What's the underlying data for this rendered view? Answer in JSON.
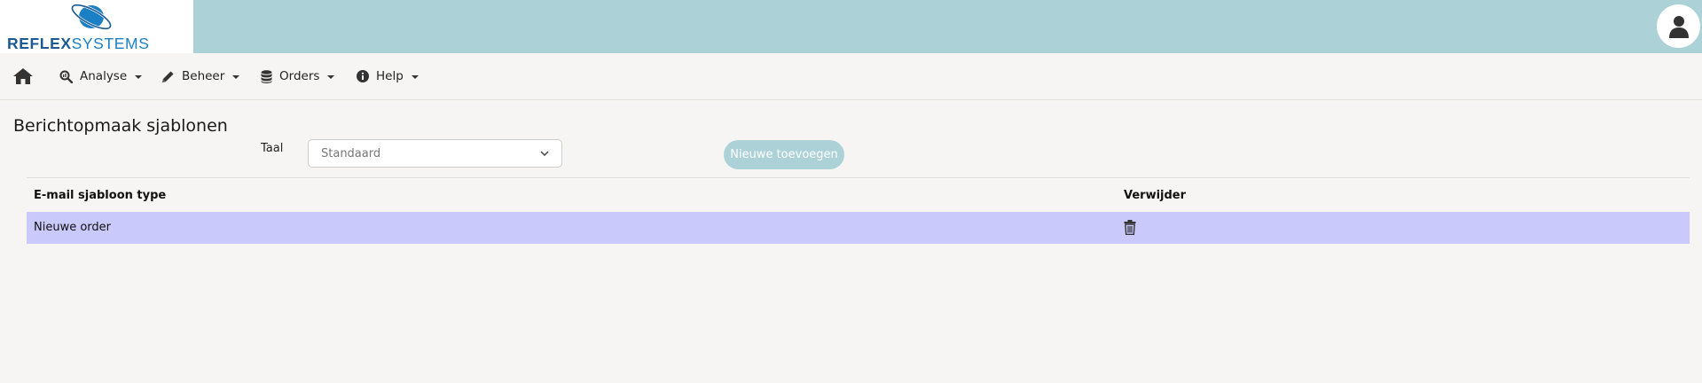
{
  "brand": {
    "logo_part1": "REFLEX",
    "logo_part2": "SYSTEMS"
  },
  "nav": {
    "items": [
      {
        "label": "Analyse",
        "icon": "search-chart-icon"
      },
      {
        "label": "Beheer",
        "icon": "pencil-icon"
      },
      {
        "label": "Orders",
        "icon": "database-icon"
      },
      {
        "label": "Help",
        "icon": "info-icon"
      }
    ]
  },
  "page": {
    "title": "Berichtopmaak sjablonen",
    "language_label": "Taal",
    "language_value": "Standaard",
    "add_button": "Nieuwe toevoegen"
  },
  "table": {
    "columns": [
      "E-mail sjabloon type",
      "Verwijder"
    ],
    "rows": [
      {
        "type": "Nieuwe order",
        "delete_icon": "trash-icon"
      }
    ]
  },
  "colors": {
    "header_bg": "#acd2d8",
    "row_highlight": "#c9c9fb",
    "page_bg": "#f7f5f3"
  }
}
